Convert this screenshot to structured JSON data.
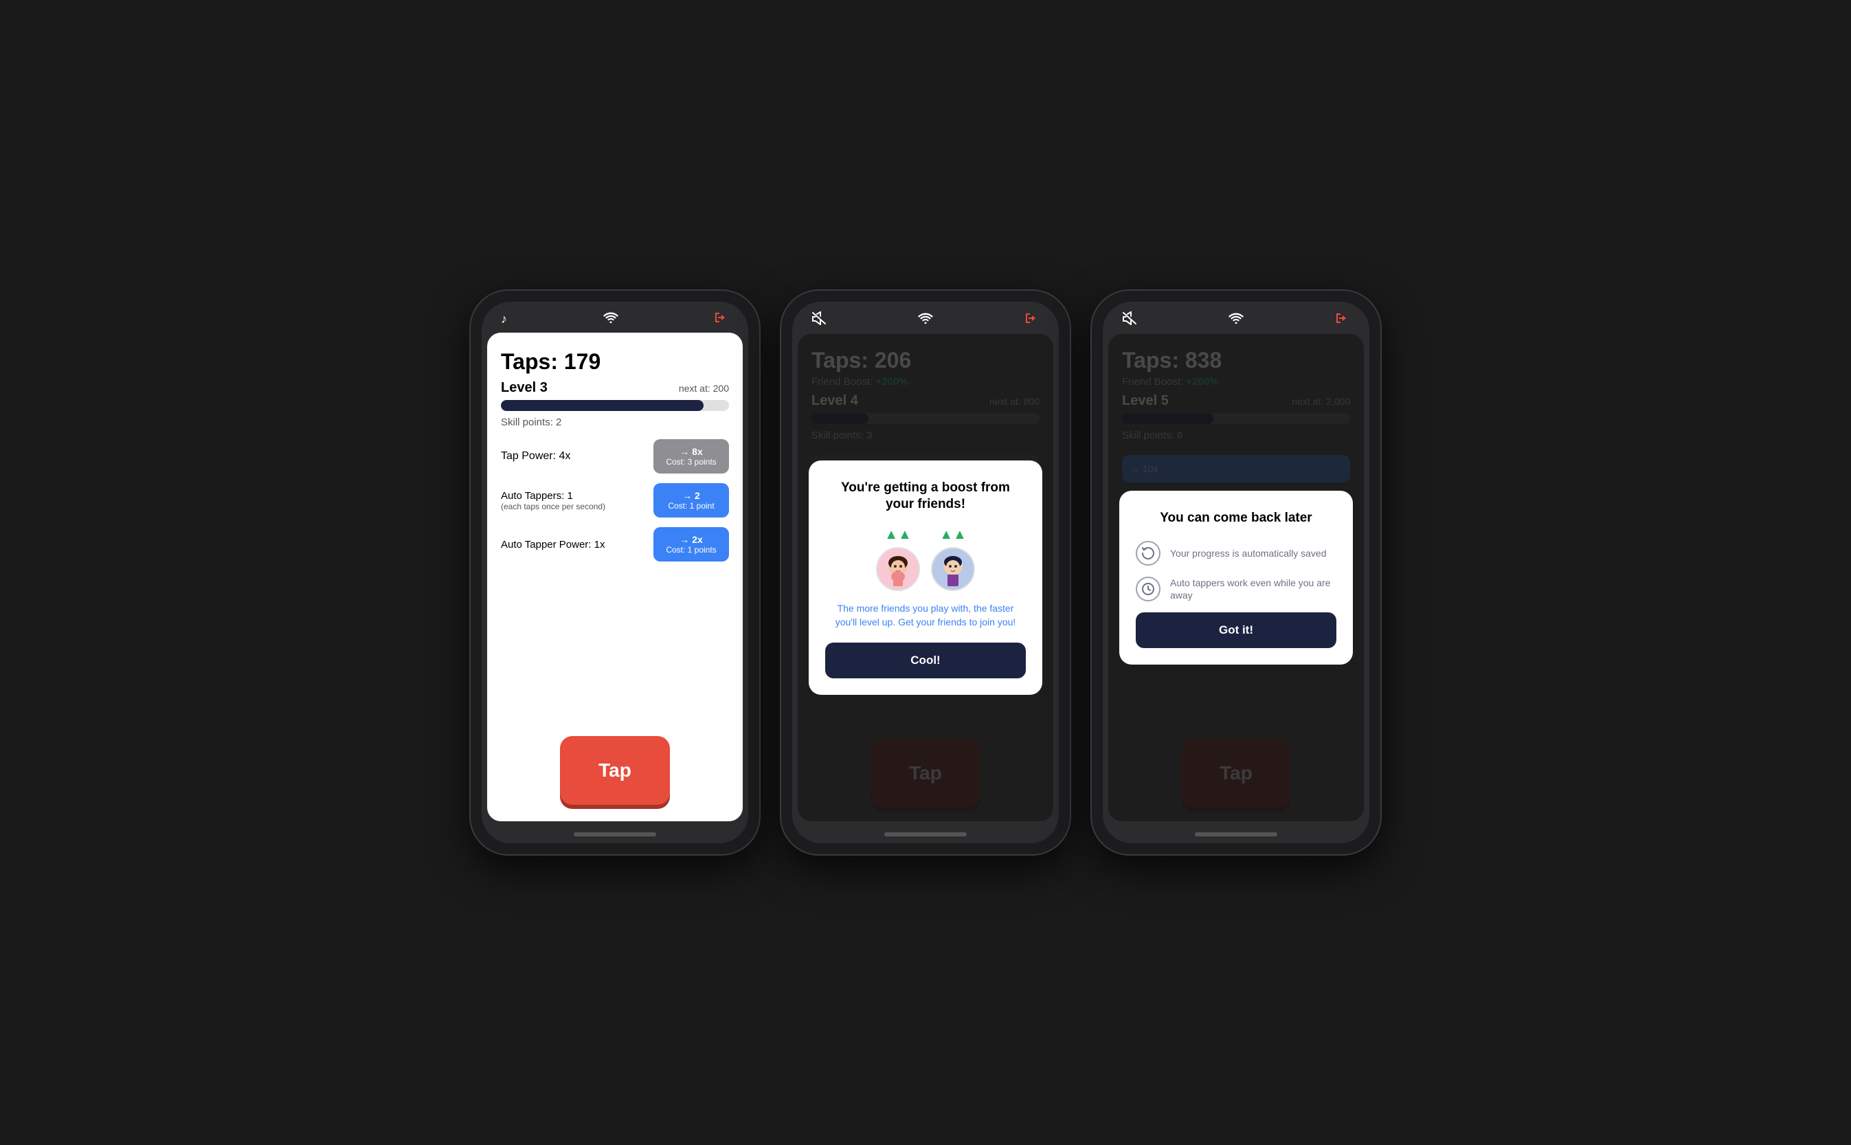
{
  "phone1": {
    "status": {
      "icon1": "♪",
      "icon2": "wifi",
      "icon3": "exit"
    },
    "taps": "Taps: 179",
    "level": "Level 3",
    "next_at": "next at: 200",
    "progress_pct": 89,
    "skill_points": "Skill points: 2",
    "tap_power_label": "Tap Power: 4x",
    "tap_power_btn_line1": "→ 8x",
    "tap_power_btn_line2": "Cost: 3 points",
    "auto_tappers_label": "Auto Tappers: 1",
    "auto_tappers_sub": "(each taps once per second)",
    "auto_tappers_btn_line1": "→ 2",
    "auto_tappers_btn_line2": "Cost: 1 point",
    "auto_tapper_power_label": "Auto Tapper Power: 1x",
    "auto_tapper_power_btn_line1": "→ 2x",
    "auto_tapper_power_btn_line2": "Cost: 1 points",
    "tap_button": "Tap"
  },
  "phone2": {
    "taps": "Taps: 206",
    "friend_boost": "+200%",
    "level": "Level 4",
    "next_at": "next at: 800",
    "progress_pct": 25,
    "skill_points": "Skill points: 3",
    "tap_button": "Tap",
    "modal": {
      "title": "You're getting a boost from your friends!",
      "description": "The more friends you play with, the faster you'll level up. Get your friends to join you!",
      "button": "Cool!"
    }
  },
  "phone3": {
    "taps": "Taps: 838",
    "friend_boost": "+200%",
    "level": "Level 5",
    "next_at": "next at: 2,000",
    "progress_pct": 40,
    "skill_points": "Skill points: 6",
    "tap_button": "Tap",
    "modal": {
      "title": "You can come back later",
      "info1": "Your progress is automatically saved",
      "info2": "Auto tappers work even while you are away",
      "button": "Got it!"
    }
  }
}
